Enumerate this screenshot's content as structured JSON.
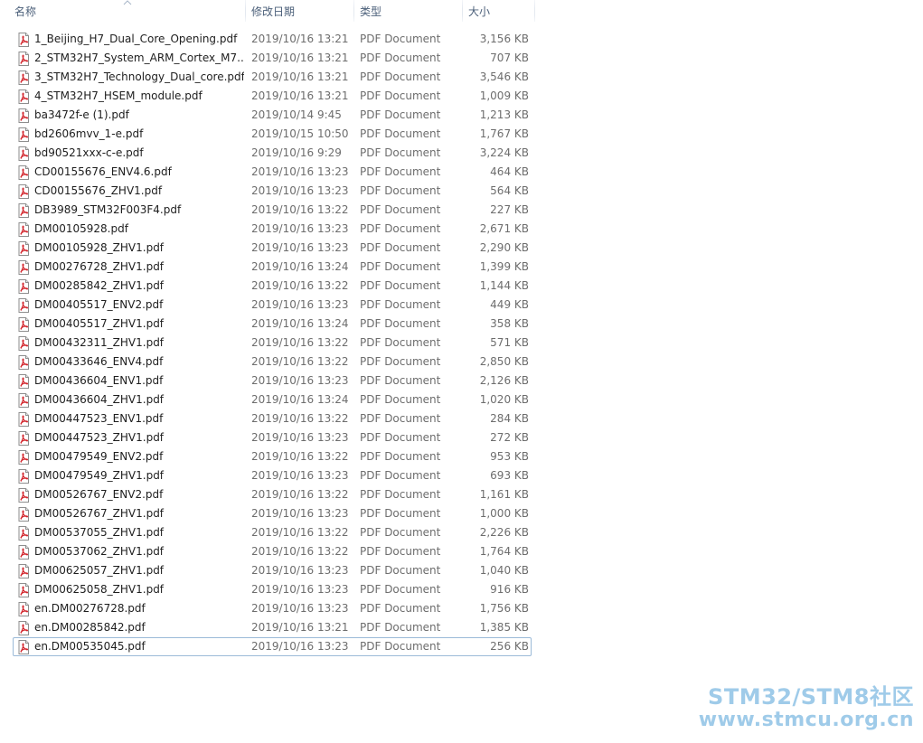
{
  "columns": {
    "name": "名称",
    "date": "修改日期",
    "type": "类型",
    "size": "大小"
  },
  "sort": {
    "column": "name",
    "direction": "ascending",
    "icon": "sort-ascending-arrow"
  },
  "file_icon": "pdf-file-icon",
  "accent_colors": {
    "focus_border": "#9bbad8",
    "pdf_red": "#d2232a"
  },
  "files": [
    {
      "name": "1_Beijing_H7_Dual_Core_Opening.pdf",
      "date": "2019/10/16 13:21",
      "type": "PDF Document",
      "size": "3,156 KB"
    },
    {
      "name": "2_STM32H7_System_ARM_Cortex_M7...",
      "date": "2019/10/16 13:21",
      "type": "PDF Document",
      "size": "707 KB"
    },
    {
      "name": "3_STM32H7_Technology_Dual_core.pdf",
      "date": "2019/10/16 13:21",
      "type": "PDF Document",
      "size": "3,546 KB"
    },
    {
      "name": "4_STM32H7_HSEM_module.pdf",
      "date": "2019/10/16 13:21",
      "type": "PDF Document",
      "size": "1,009 KB"
    },
    {
      "name": "ba3472f-e (1).pdf",
      "date": "2019/10/14 9:45",
      "type": "PDF Document",
      "size": "1,213 KB"
    },
    {
      "name": "bd2606mvv_1-e.pdf",
      "date": "2019/10/15 10:50",
      "type": "PDF Document",
      "size": "1,767 KB"
    },
    {
      "name": "bd90521xxx-c-e.pdf",
      "date": "2019/10/16 9:29",
      "type": "PDF Document",
      "size": "3,224 KB"
    },
    {
      "name": "CD00155676_ENV4.6.pdf",
      "date": "2019/10/16 13:23",
      "type": "PDF Document",
      "size": "464 KB"
    },
    {
      "name": "CD00155676_ZHV1.pdf",
      "date": "2019/10/16 13:23",
      "type": "PDF Document",
      "size": "564 KB"
    },
    {
      "name": "DB3989_STM32F003F4.pdf",
      "date": "2019/10/16 13:22",
      "type": "PDF Document",
      "size": "227 KB"
    },
    {
      "name": "DM00105928.pdf",
      "date": "2019/10/16 13:23",
      "type": "PDF Document",
      "size": "2,671 KB"
    },
    {
      "name": "DM00105928_ZHV1.pdf",
      "date": "2019/10/16 13:23",
      "type": "PDF Document",
      "size": "2,290 KB"
    },
    {
      "name": "DM00276728_ZHV1.pdf",
      "date": "2019/10/16 13:24",
      "type": "PDF Document",
      "size": "1,399 KB"
    },
    {
      "name": "DM00285842_ZHV1.pdf",
      "date": "2019/10/16 13:22",
      "type": "PDF Document",
      "size": "1,144 KB"
    },
    {
      "name": "DM00405517_ENV2.pdf",
      "date": "2019/10/16 13:23",
      "type": "PDF Document",
      "size": "449 KB"
    },
    {
      "name": "DM00405517_ZHV1.pdf",
      "date": "2019/10/16 13:24",
      "type": "PDF Document",
      "size": "358 KB"
    },
    {
      "name": "DM00432311_ZHV1.pdf",
      "date": "2019/10/16 13:22",
      "type": "PDF Document",
      "size": "571 KB"
    },
    {
      "name": "DM00433646_ENV4.pdf",
      "date": "2019/10/16 13:22",
      "type": "PDF Document",
      "size": "2,850 KB"
    },
    {
      "name": "DM00436604_ENV1.pdf",
      "date": "2019/10/16 13:23",
      "type": "PDF Document",
      "size": "2,126 KB"
    },
    {
      "name": "DM00436604_ZHV1.pdf",
      "date": "2019/10/16 13:24",
      "type": "PDF Document",
      "size": "1,020 KB"
    },
    {
      "name": "DM00447523_ENV1.pdf",
      "date": "2019/10/16 13:22",
      "type": "PDF Document",
      "size": "284 KB"
    },
    {
      "name": "DM00447523_ZHV1.pdf",
      "date": "2019/10/16 13:23",
      "type": "PDF Document",
      "size": "272 KB"
    },
    {
      "name": "DM00479549_ENV2.pdf",
      "date": "2019/10/16 13:22",
      "type": "PDF Document",
      "size": "953 KB"
    },
    {
      "name": "DM00479549_ZHV1.pdf",
      "date": "2019/10/16 13:23",
      "type": "PDF Document",
      "size": "693 KB"
    },
    {
      "name": "DM00526767_ENV2.pdf",
      "date": "2019/10/16 13:22",
      "type": "PDF Document",
      "size": "1,161 KB"
    },
    {
      "name": "DM00526767_ZHV1.pdf",
      "date": "2019/10/16 13:23",
      "type": "PDF Document",
      "size": "1,000 KB"
    },
    {
      "name": "DM00537055_ZHV1.pdf",
      "date": "2019/10/16 13:22",
      "type": "PDF Document",
      "size": "2,226 KB"
    },
    {
      "name": "DM00537062_ZHV1.pdf",
      "date": "2019/10/16 13:22",
      "type": "PDF Document",
      "size": "1,764 KB"
    },
    {
      "name": "DM00625057_ZHV1.pdf",
      "date": "2019/10/16 13:23",
      "type": "PDF Document",
      "size": "1,040 KB"
    },
    {
      "name": "DM00625058_ZHV1.pdf",
      "date": "2019/10/16 13:23",
      "type": "PDF Document",
      "size": "916 KB"
    },
    {
      "name": "en.DM00276728.pdf",
      "date": "2019/10/16 13:23",
      "type": "PDF Document",
      "size": "1,756 KB"
    },
    {
      "name": "en.DM00285842.pdf",
      "date": "2019/10/16 13:21",
      "type": "PDF Document",
      "size": "1,385 KB"
    },
    {
      "name": "en.DM00535045.pdf",
      "date": "2019/10/16 13:23",
      "type": "PDF Document",
      "size": "256 KB",
      "focused": true
    }
  ],
  "watermark": {
    "line1": "STM32/STM8社区",
    "line2": "www.stmcu.org.cn"
  }
}
